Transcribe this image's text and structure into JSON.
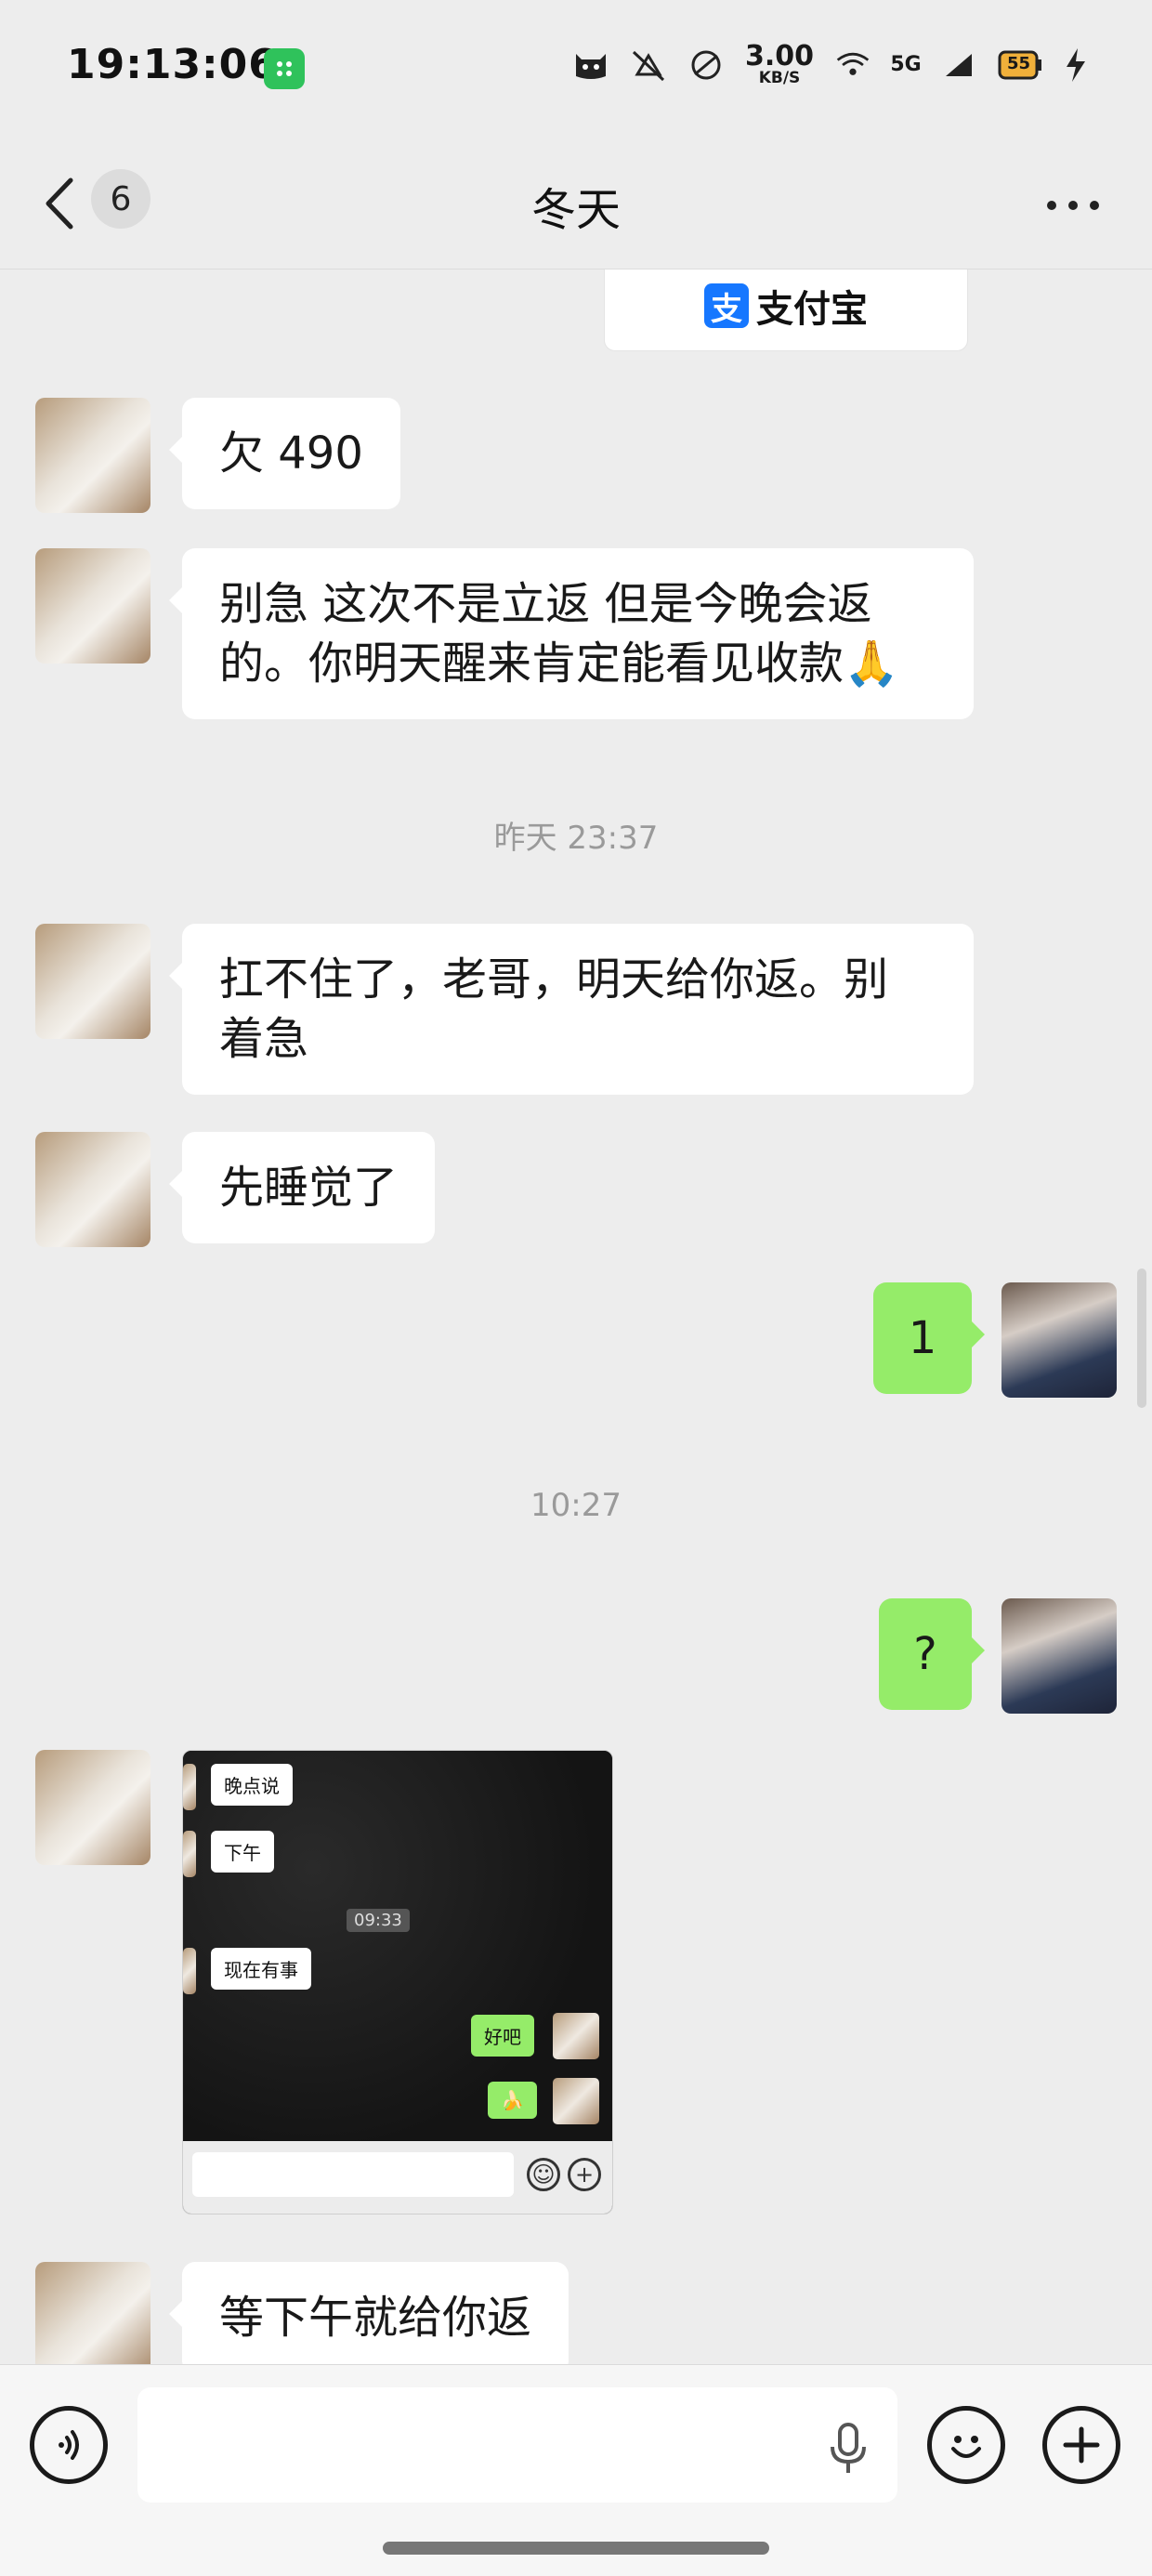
{
  "status_bar": {
    "time": "19:13:06",
    "net_speed_value": "3.00",
    "net_speed_unit": "KB/S",
    "signal": "5G",
    "battery": "55"
  },
  "nav": {
    "unread_count": "6",
    "title": "冬天"
  },
  "alipay_card": {
    "label": "支付宝",
    "logo_glyph": "支"
  },
  "messages": [
    {
      "side": "left",
      "text": "欠 490"
    },
    {
      "side": "left",
      "line1": "别急 这次不是立返 但是今晚会返",
      "line2": "的。你明天醒来肯定能看见收款",
      "emoji": "🙏"
    },
    {
      "side": "timestamp",
      "text": "昨天 23:37"
    },
    {
      "side": "left",
      "line1": "扛不住了，老哥，明天给你返。别",
      "line2": "着急"
    },
    {
      "side": "left",
      "text": "先睡觉了"
    },
    {
      "side": "right",
      "text": "1"
    },
    {
      "side": "timestamp",
      "text": "10:27"
    },
    {
      "side": "right",
      "text": "?"
    },
    {
      "side": "left",
      "type": "image"
    },
    {
      "side": "left",
      "text": "等下午就给你返"
    }
  ],
  "screenshot": {
    "msg1": "晚点说",
    "msg2": "下午",
    "timestamp": "09:33",
    "msg3": "现在有事",
    "msg4": "好吧",
    "msg5": "🍌"
  }
}
